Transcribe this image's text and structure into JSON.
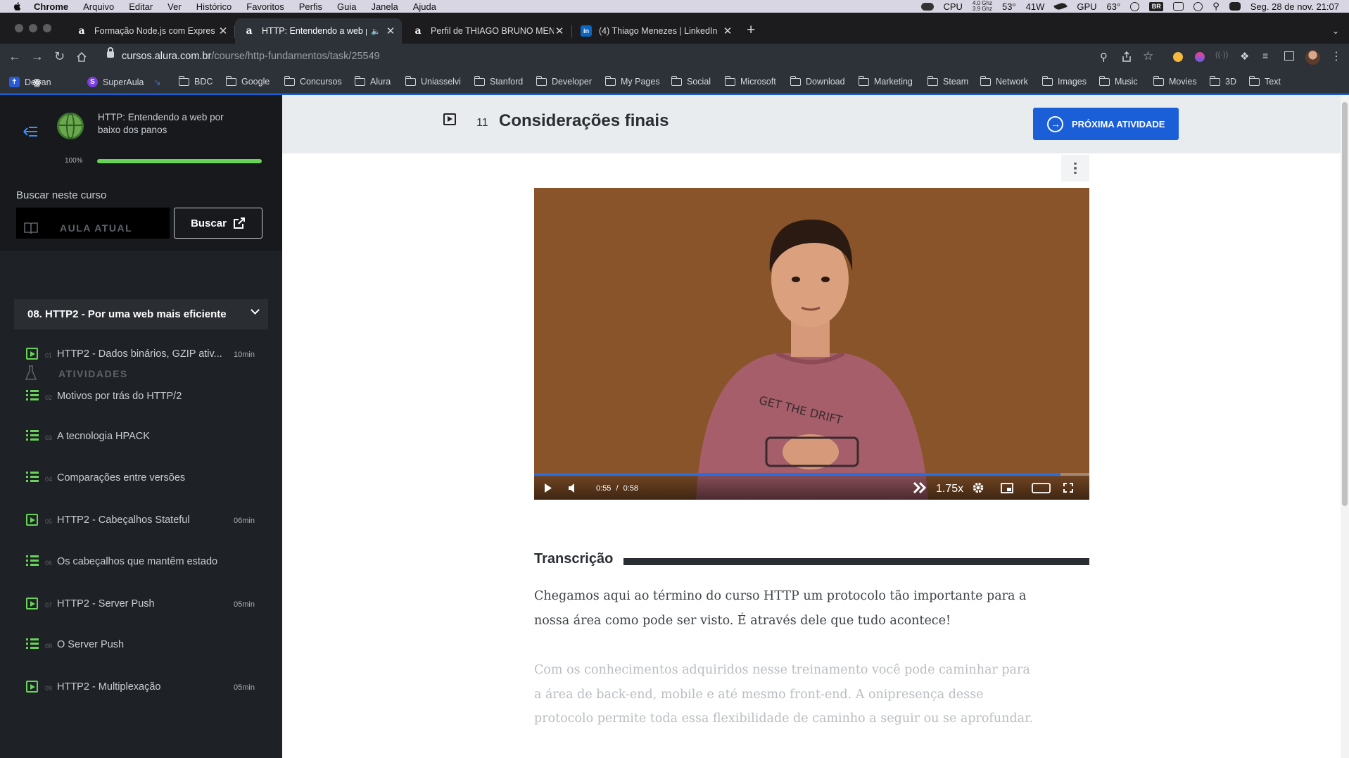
{
  "menubar": {
    "items": [
      "Chrome",
      "Arquivo",
      "Editar",
      "Ver",
      "Histórico",
      "Favoritos",
      "Perfis",
      "Guia",
      "Janela",
      "Ajuda"
    ],
    "cpu_label": "CPU",
    "cpu_freq_top": "4.0 Ghz",
    "cpu_freq_bottom": "3.9 Ghz",
    "cpu_temp": "53°",
    "power": "41W",
    "gpu_label": "GPU",
    "gpu_temp": "63°",
    "input_lang": "BR",
    "datetime": "Seg. 28 de nov.  21:07"
  },
  "tabs": [
    {
      "title": "Formação Node.js com Expres",
      "favicon": "alura-icon",
      "active": false
    },
    {
      "title": "HTTP: Entendendo a web p",
      "favicon": "alura-icon",
      "active": true,
      "audio": true
    },
    {
      "title": "Perfil de THIAGO BRUNO MEN",
      "favicon": "alura-icon",
      "active": false
    },
    {
      "title": "(4) Thiago Menezes | LinkedIn",
      "favicon": "linkedin-icon",
      "active": false
    }
  ],
  "address": {
    "host": "cursos.alura.com.br",
    "path": "/course/http-fundamentos/task/25549"
  },
  "bookmarks": [
    {
      "label": "Detran",
      "icon": "detran-icon"
    },
    {
      "label": "SuperAula",
      "icon": "superaula-icon"
    },
    {
      "label": "BDC",
      "icon": "folder-icon"
    },
    {
      "label": "Google",
      "icon": "folder-icon"
    },
    {
      "label": "Concursos",
      "icon": "folder-icon"
    },
    {
      "label": "Alura",
      "icon": "folder-icon"
    },
    {
      "label": "Uniasselvi",
      "icon": "folder-icon"
    },
    {
      "label": "Stanford",
      "icon": "folder-icon"
    },
    {
      "label": "Developer",
      "icon": "folder-icon"
    },
    {
      "label": "My Pages",
      "icon": "folder-icon"
    },
    {
      "label": "Social",
      "icon": "folder-icon"
    },
    {
      "label": "Microsoft",
      "icon": "folder-icon"
    },
    {
      "label": "Download",
      "icon": "folder-icon"
    },
    {
      "label": "Marketing",
      "icon": "folder-icon"
    },
    {
      "label": "Steam",
      "icon": "folder-icon"
    },
    {
      "label": "Network",
      "icon": "folder-icon"
    },
    {
      "label": "Images",
      "icon": "folder-icon"
    },
    {
      "label": "Music",
      "icon": "folder-icon"
    },
    {
      "label": "Movies",
      "icon": "folder-icon"
    },
    {
      "label": "3D",
      "icon": "folder-icon"
    },
    {
      "label": "Text",
      "icon": "folder-icon"
    }
  ],
  "sidebar": {
    "course_title": "HTTP: Entendendo a web por baixo dos panos",
    "progress_label": "100%",
    "progress_value": 1.0,
    "search_label": "Buscar neste curso",
    "search_value": "",
    "search_button": "Buscar",
    "current_lesson_label": "AULA ATUAL",
    "current_lesson": "08. HTTP2 - Por uma web mais eficiente",
    "activities_label": "ATIVIDADES",
    "activities": [
      {
        "num": "01",
        "label": "HTTP2 - Dados binários, GZIP ativ...",
        "duration": "10min",
        "type": "video"
      },
      {
        "num": "02",
        "label": "Motivos por trás do HTTP/2",
        "duration": "",
        "type": "list"
      },
      {
        "num": "03",
        "label": "A tecnologia HPACK",
        "duration": "",
        "type": "list"
      },
      {
        "num": "04",
        "label": "Comparações entre versões",
        "duration": "",
        "type": "list"
      },
      {
        "num": "05",
        "label": "HTTP2 - Cabeçalhos Stateful",
        "duration": "06min",
        "type": "video"
      },
      {
        "num": "06",
        "label": "Os cabeçalhos que mantêm estado",
        "duration": "",
        "type": "list"
      },
      {
        "num": "07",
        "label": "HTTP2 - Server Push",
        "duration": "05min",
        "type": "video"
      },
      {
        "num": "08",
        "label": "O Server Push",
        "duration": "",
        "type": "list"
      },
      {
        "num": "09",
        "label": "HTTP2 - Multiplexação",
        "duration": "05min",
        "type": "video"
      }
    ]
  },
  "main": {
    "task_number": "11",
    "task_title": "Considerações finais",
    "next_button": "PRÓXIMA ATIVIDADE",
    "video": {
      "current_time": "0:55",
      "separator": "/",
      "duration": "0:58",
      "progress": 0.948,
      "speed": "1.75x"
    },
    "transcript_title": "Transcrição",
    "paragraphs": [
      "Chegamos aqui ao término do curso HTTP um protocolo tão importante para a nossa área como pode ser visto. É através dele que tudo acontece!",
      "Com os conhecimentos adquiridos nesse treinamento você pode caminhar para a área de back-end, mobile e até mesmo front-end. A onipresença desse protocolo permite toda essa flexibilidade de caminho a seguir ou se aprofundar."
    ]
  },
  "colors": {
    "accent": "#1a5ed8",
    "progress_green": "#68d358",
    "sidebar_bg": "#1e2125",
    "video_bg": "#89542a"
  }
}
